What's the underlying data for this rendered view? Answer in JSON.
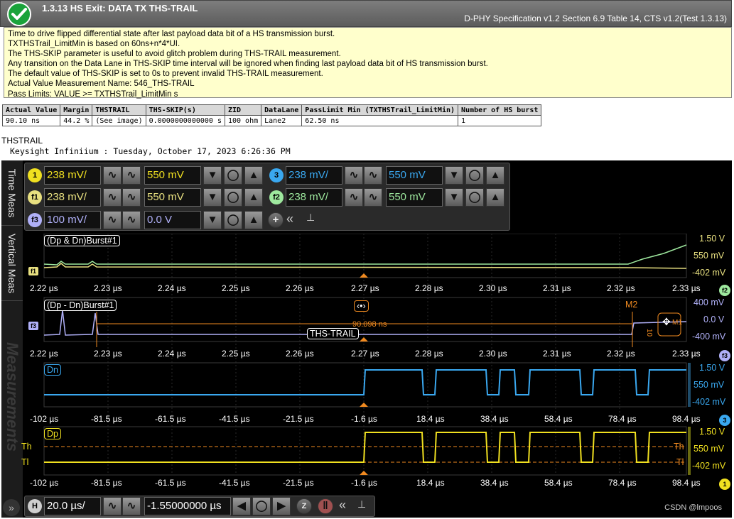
{
  "header": {
    "title": "1.3.13 HS Exit: DATA TX THS-TRAIL",
    "spec": "D-PHY Specification v1.2 Section 6.9 Table 14, CTS v1.2(Test 1.3.13)"
  },
  "description": [
    "Time to drive flipped differential state after last payload data bit of a HS transmission burst.",
    "TXTHSTrail_LimitMin is based on 60ns+n*4*UI.",
    "The THS-SKIP parameter is useful to avoid glitch problem during THS-TRAIL measurement.",
    "Any transition on the Data Lane in THS-SKIP time interval will be ignored when finding last payload data bit of HS transmission burst.",
    "The default value of THS-SKIP is set to 0s to prevent invalid THS-TRAIL measurement.",
    "Actual Value Measurement Name: 546_THS-TRAIL",
    "Pass Limits: VALUE >= TXTHSTrail_LimitMin s"
  ],
  "results": {
    "headers": [
      "Actual Value",
      "Margin",
      "THSTRAIL",
      "THS-SKIP(s)",
      "ZID",
      "DataLane",
      "PassLimit Min (TXTHSTrail_LimitMin)",
      "Number of HS burst"
    ],
    "row": [
      "90.10 ns",
      "44.2 %",
      "(See image)",
      "0.0000000000000 s",
      "100 ohm",
      "Lane2",
      "62.50 ns",
      "1"
    ]
  },
  "image_label": "THSTRAIL",
  "scope_id": "Keysight Infiniium : Tuesday, October 17, 2023 6:26:36 PM",
  "scope": {
    "side_tabs": [
      "Time Meas",
      "Vertical Meas",
      "Measurements"
    ],
    "channels": [
      {
        "badge": "1",
        "scale": "238 mV/",
        "offset": "550 mV",
        "color": "#f0e020"
      },
      {
        "badge": "3",
        "scale": "238 mV/",
        "offset": "550 mV",
        "color": "#3aa8f0"
      },
      {
        "badge": "f1",
        "scale": "238 mV/",
        "offset": "550 mV",
        "color": "#e8e080"
      },
      {
        "badge": "f2",
        "scale": "238 mV/",
        "offset": "550 mV",
        "color": "#9ee89e"
      },
      {
        "badge": "f3",
        "scale": "100 mV/",
        "offset": "0.0 V",
        "color": "#b0b0f8"
      }
    ],
    "panels": {
      "p1": {
        "label": "(Dp & Dn)Burst#1",
        "right": [
          "1.50 V",
          "550 mV",
          "-402 mV"
        ],
        "marker": "f1",
        "end_badge": "f2"
      },
      "p2": {
        "label": "(Dp - Dn)Burst#1",
        "right": [
          "400 mV",
          "0.0 V",
          "-400 mV"
        ],
        "marker": "f3",
        "end_badge": "f3",
        "cursor_label": "M2",
        "delta": "90.098 ns",
        "meas_label": "THS-TRAIL",
        "cursor_small": "M1",
        "cursor_v": "10"
      },
      "p3": {
        "label": "Dn",
        "right": [
          "1.50 V",
          "550 mV",
          "-402 mV"
        ],
        "end_badge": "3"
      },
      "p4": {
        "label": "Dp",
        "right": [
          "1.50 V",
          "550 mV",
          "-402 mV"
        ],
        "end_badge": "1",
        "th": "Th",
        "tl": "Tl"
      }
    },
    "ticks_top": [
      "2.22 µs",
      "2.23 µs",
      "2.24 µs",
      "2.25 µs",
      "2.26 µs",
      "2.27 µs",
      "2.28 µs",
      "2.30 µs",
      "2.31 µs",
      "2.32 µs",
      "2.33 µs"
    ],
    "ticks_bottom": [
      "-102 µs",
      "-81.5 µs",
      "-61.5 µs",
      "-41.5 µs",
      "-21.5 µs",
      "-1.6 µs",
      "18.4 µs",
      "38.4 µs",
      "58.4 µs",
      "78.4 µs",
      "98.4 µs"
    ],
    "horizontal": {
      "badge": "H",
      "scale": "20.0 µs/",
      "position": "-1.55000000 µs"
    },
    "watermark": "CSDN @lmpoos"
  }
}
